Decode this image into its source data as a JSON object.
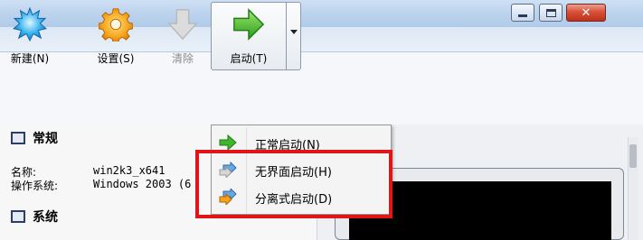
{
  "window_controls": {
    "minimize": "minimize",
    "maximize": "maximize",
    "close": "close"
  },
  "toolbar": {
    "new_label": "新建(N)",
    "settings_label": "设置(S)",
    "discard_label": "清除",
    "start_label": "启动(T)"
  },
  "details": {
    "general_heading": "常规",
    "name_label": "名称:",
    "name_value": "win2k3_x641",
    "os_label": "操作系统:",
    "os_value": "Windows 2003 (6",
    "system_heading": "系统"
  },
  "start_menu": {
    "items": [
      {
        "label": "正常启动(N)",
        "icon": "green-arrow-icon"
      },
      {
        "label": "无界面启动(H)",
        "icon": "headless-arrow-icon"
      },
      {
        "label": "分离式启动(D)",
        "icon": "detachable-arrow-icon"
      }
    ]
  },
  "colors": {
    "highlight": "#e2141a",
    "accent_green": "#3db82b"
  }
}
